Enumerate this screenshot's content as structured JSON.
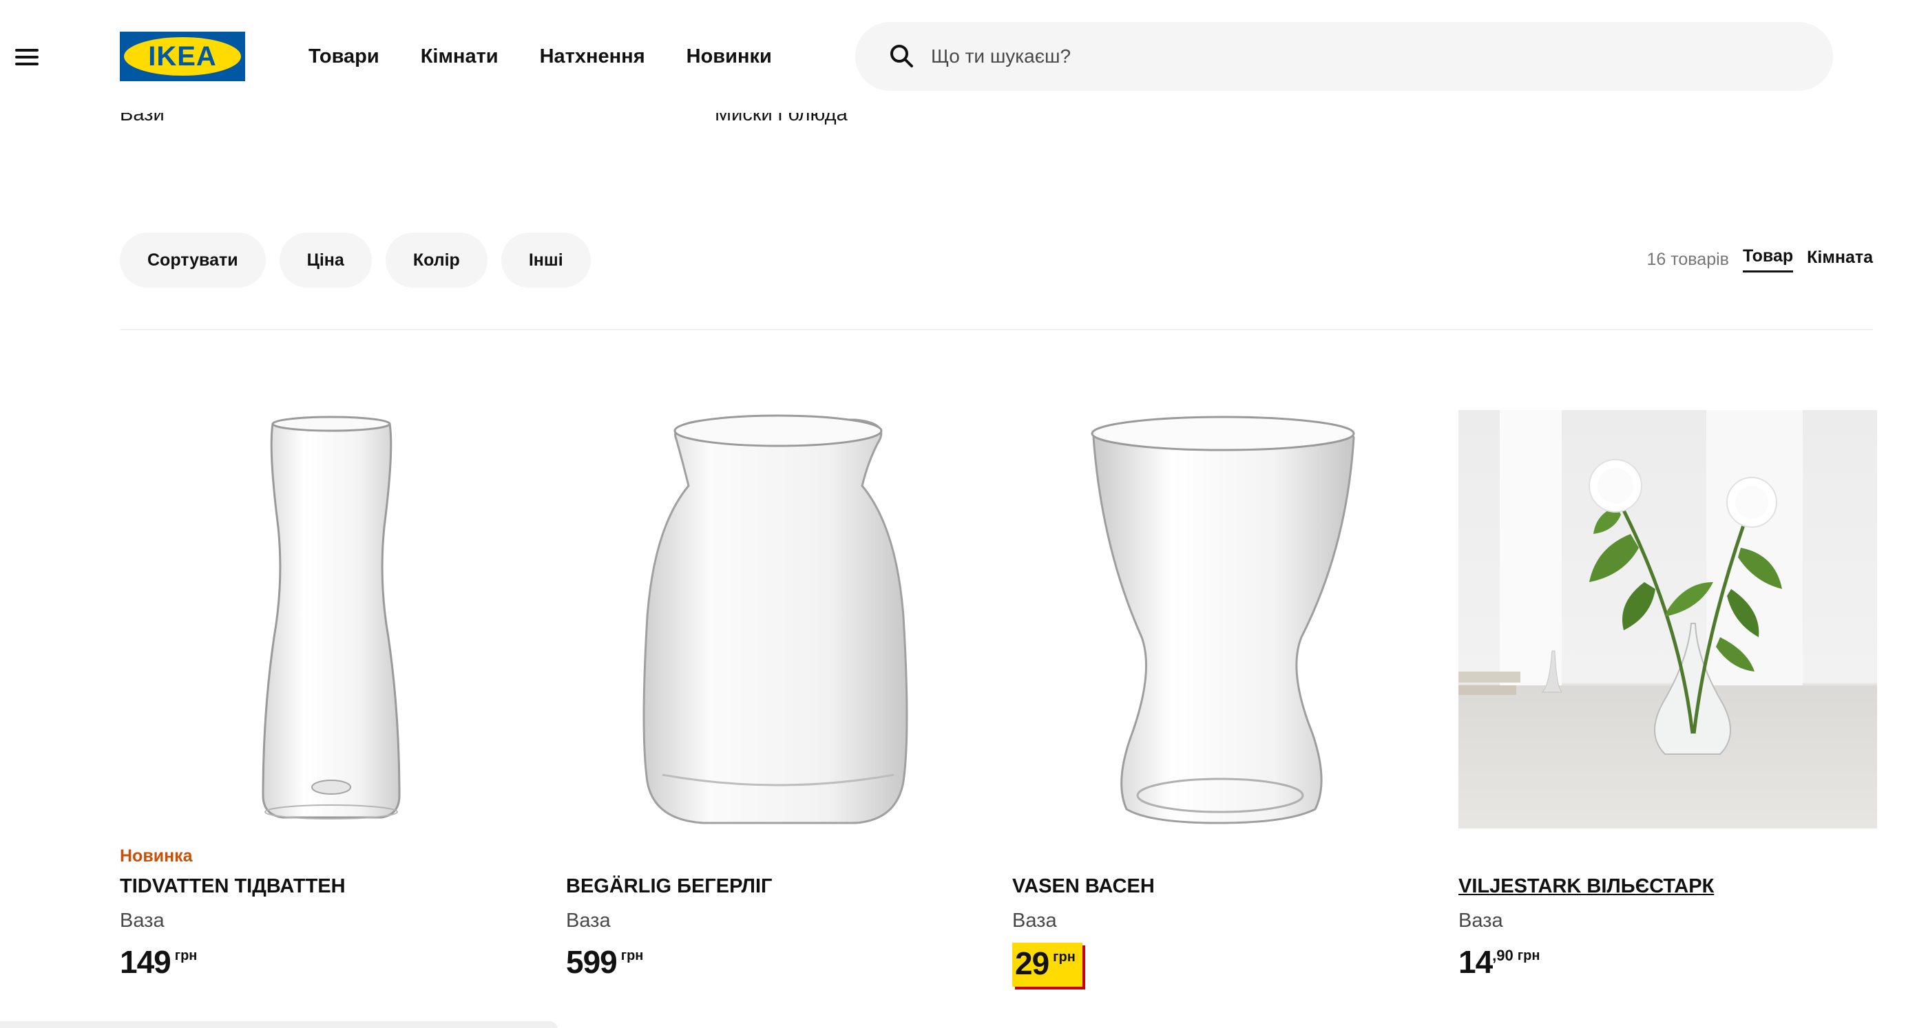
{
  "header": {
    "logo_text": "IKEA",
    "nav": [
      "Товари",
      "Кімнати",
      "Натхнення",
      "Новинки"
    ],
    "search_placeholder": "Що ти шукаєш?"
  },
  "category_links": [
    "Вази",
    "Миски і блюда"
  ],
  "filters": [
    "Сортувати",
    "Ціна",
    "Колір",
    "Інші"
  ],
  "results": {
    "count": "16 товарів",
    "view_product": "Товар",
    "view_room": "Кімната"
  },
  "products": [
    {
      "badge": "Новинка",
      "name": "TIDVATTEN ТІДВАТТЕН",
      "type": "Ваза",
      "price": "149",
      "decimal": "",
      "currency": "грн"
    },
    {
      "badge": "",
      "name": "BEGÄRLIG БЕГЕРЛІГ",
      "type": "Ваза",
      "price": "599",
      "decimal": "",
      "currency": "грн"
    },
    {
      "badge": "",
      "name": "VASEN ВАСЕН",
      "type": "Ваза",
      "price": "29",
      "decimal": "",
      "currency": "грн",
      "highlight": true
    },
    {
      "badge": "",
      "name": "VILJESTARK ВІЛЬЄСТАРК",
      "type": "Ваза",
      "price": "14",
      "decimal": ",90",
      "currency": "грн"
    }
  ],
  "colors": {
    "ikea_blue": "#0058a3",
    "ikea_yellow": "#ffdb00",
    "new_badge": "#ca5008",
    "price_shadow": "#cc0008"
  }
}
